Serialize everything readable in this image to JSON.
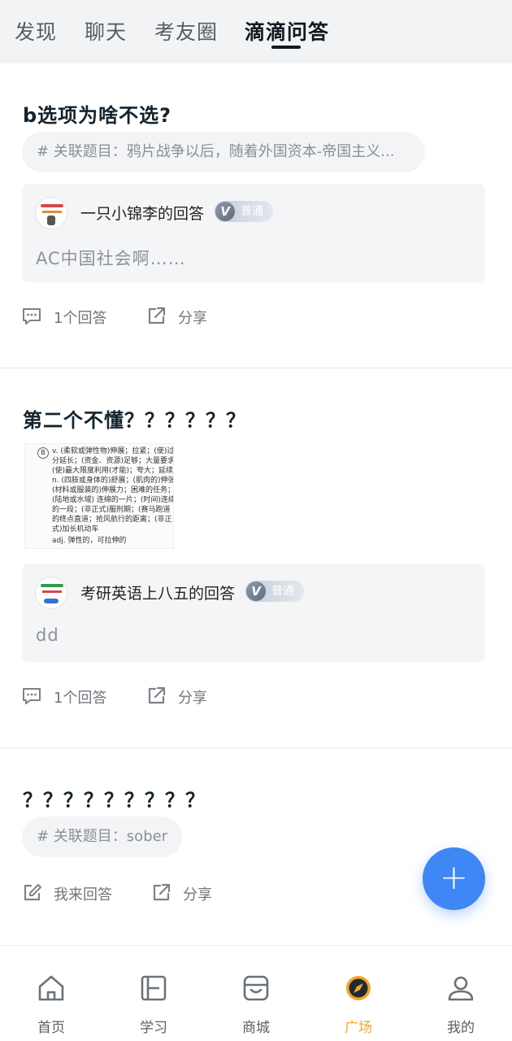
{
  "tabs": [
    {
      "label": "发现"
    },
    {
      "label": "聊天"
    },
    {
      "label": "考友圈"
    },
    {
      "label": "滴滴问答"
    }
  ],
  "active_tab": "滴滴问答",
  "posts": [
    {
      "title": "b选项为啥不选?",
      "related": "# 关联题目：鸦片战争以后，随着外国资本-帝国主义...",
      "answer": {
        "author": "一只小锦李的回答",
        "badge": "普通",
        "text": "AC中国社会啊……"
      },
      "actions": {
        "primary": "1个回答",
        "share": "分享"
      }
    },
    {
      "title": "第二个不懂？？？？？？",
      "image": {
        "letter": "B",
        "lines": [
          "v. (柔软或弹性物)伸展；拉紧；(使)过",
          "分延长；(资金、资源)足够；大量要求；",
          "(使)最大限度利用(才能)；夸大；延续",
          "n. (四肢或身体的)舒展；(肌肉的)伸张；",
          "(材料或服装的)伸展力；困难的任务；",
          "(陆地或水域) 连绵的一片；(时间)连续",
          "的一段；(非正式)服刑期；(赛马跑道",
          "的终点直道；抢风航行的距离；(非正",
          "式)加长机动车",
          "adj. 弹性的，可拉伸的"
        ]
      },
      "answer": {
        "author": "考研英语上八五的回答",
        "badge": "普通",
        "text": "dd"
      },
      "actions": {
        "primary": "1个回答",
        "share": "分享"
      }
    },
    {
      "title": "？？？？？？？？？",
      "related": "# 关联题目：sober",
      "actions": {
        "primary": "我来回答",
        "share": "分享"
      }
    }
  ],
  "fab": {
    "label": "+"
  },
  "bottom_nav": [
    {
      "label": "首页",
      "icon": "home-icon"
    },
    {
      "label": "学习",
      "icon": "study-icon"
    },
    {
      "label": "商城",
      "icon": "shop-icon"
    },
    {
      "label": "广场",
      "icon": "compass-icon"
    },
    {
      "label": "我的",
      "icon": "profile-icon"
    }
  ],
  "colors": {
    "accent_orange": "#f5a623",
    "fab_blue": "#3e87f5",
    "title_text": "#13232d"
  }
}
